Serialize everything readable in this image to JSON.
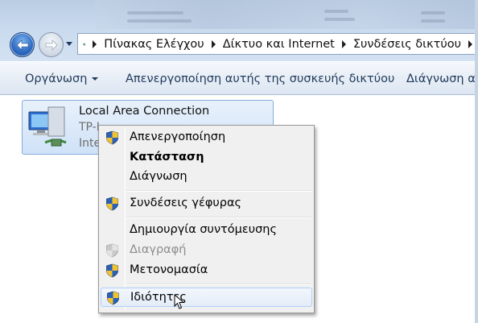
{
  "address_bar": {
    "breadcrumbs": [
      "Πίνακας Ελέγχου",
      "Δίκτυο και Internet",
      "Συνδέσεις δικτύου"
    ]
  },
  "command_bar": {
    "organize_label": "Οργάνωση",
    "disable_device_label": "Απενεργοποίηση αυτής της συσκευής δικτύου",
    "diagnose_label": "Διάγνωση αυ"
  },
  "connection": {
    "name": "Local Area Connection",
    "device_partial": "TP-L",
    "status_partial": "Inte"
  },
  "context_menu": {
    "items": [
      {
        "label": "Απενεργοποίηση",
        "icon": "uac-shield-icon"
      },
      {
        "label": "Κατάσταση",
        "bold": true
      },
      {
        "label": "Διάγνωση"
      },
      {
        "label": "Συνδέσεις γέφυρας",
        "icon": "uac-shield-icon"
      },
      {
        "label": "Δημιουργία συντόμευσης"
      },
      {
        "label": "Διαγραφή",
        "icon": "uac-shield-icon",
        "disabled": true
      },
      {
        "label": "Μετονομασία",
        "icon": "uac-shield-icon"
      },
      {
        "label": "Ιδιότητες",
        "icon": "uac-shield-icon",
        "highlighted": true
      }
    ]
  },
  "colors": {
    "accent_border": "#84acdd",
    "command_text": "#1e395b",
    "menu_background": "#f0f0f0"
  }
}
